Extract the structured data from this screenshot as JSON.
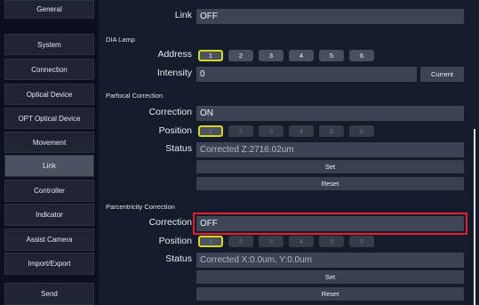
{
  "sidebar": {
    "items": [
      {
        "label": "General"
      },
      {
        "label": "System"
      },
      {
        "label": "Connection"
      },
      {
        "label": "Optical Device"
      },
      {
        "label": "OPT Optical Device"
      },
      {
        "label": "Movement"
      },
      {
        "label": "Link"
      },
      {
        "label": "Controller"
      },
      {
        "label": "Indicator"
      },
      {
        "label": "Assist Camera"
      },
      {
        "label": "Import/Export"
      }
    ],
    "send_label": "Send",
    "active": "Link"
  },
  "top": {
    "link_label": "Link",
    "link_value": "OFF"
  },
  "dia_lamp": {
    "title": "DIA Lamp",
    "address_label": "Address",
    "addresses": [
      "1",
      "2",
      "3",
      "4",
      "5",
      "6"
    ],
    "address_selected": "1",
    "intensity_label": "Intensity",
    "intensity_value": "0",
    "current_label": "Current"
  },
  "parfocal": {
    "title": "Parfocal Correction",
    "correction_label": "Correction",
    "correction_value": "ON",
    "position_label": "Position",
    "positions": [
      "1",
      "2",
      "3",
      "4",
      "5",
      "6"
    ],
    "position_selected": "1",
    "status_label": "Status",
    "status_value": "Corrected Z:2716.02um",
    "set_label": "Set",
    "reset_label": "Reset"
  },
  "parcentricity": {
    "title": "Parcentricity Correction",
    "correction_label": "Correction",
    "correction_value": "OFF",
    "position_label": "Position",
    "positions": [
      "1",
      "2",
      "3",
      "4",
      "5",
      "6"
    ],
    "position_selected": "1",
    "status_label": "Status",
    "status_value": "Corrected X:0.0um, Y:0.0um",
    "set_label": "Set",
    "reset_label": "Reset"
  },
  "colors": {
    "highlight": "#e81f26",
    "selected_outline": "#d6d820",
    "active_nav": "#4b5262"
  }
}
